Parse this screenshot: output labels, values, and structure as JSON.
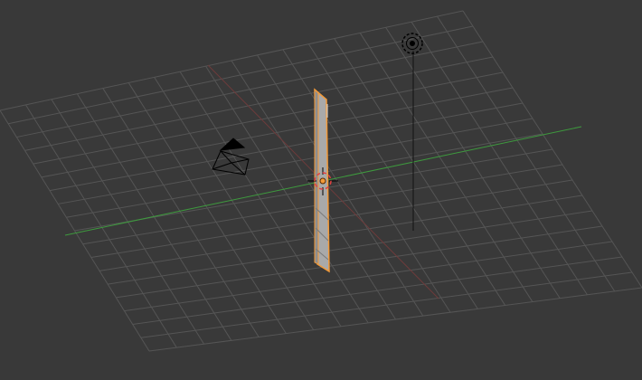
{
  "viewport": {
    "background": "#393939",
    "grid_color": "#555555",
    "x_axis_color": "#7a3f3f",
    "y_axis_color": "#3e9a3e",
    "selection_color": "#f29a3a"
  },
  "scene_objects": [
    {
      "name": "Camera",
      "icon": "camera-icon",
      "selected": false
    },
    {
      "name": "Lamp",
      "icon": "lamp-icon",
      "selected": false
    },
    {
      "name": "Cube",
      "icon": "mesh-icon",
      "selected": true
    }
  ]
}
